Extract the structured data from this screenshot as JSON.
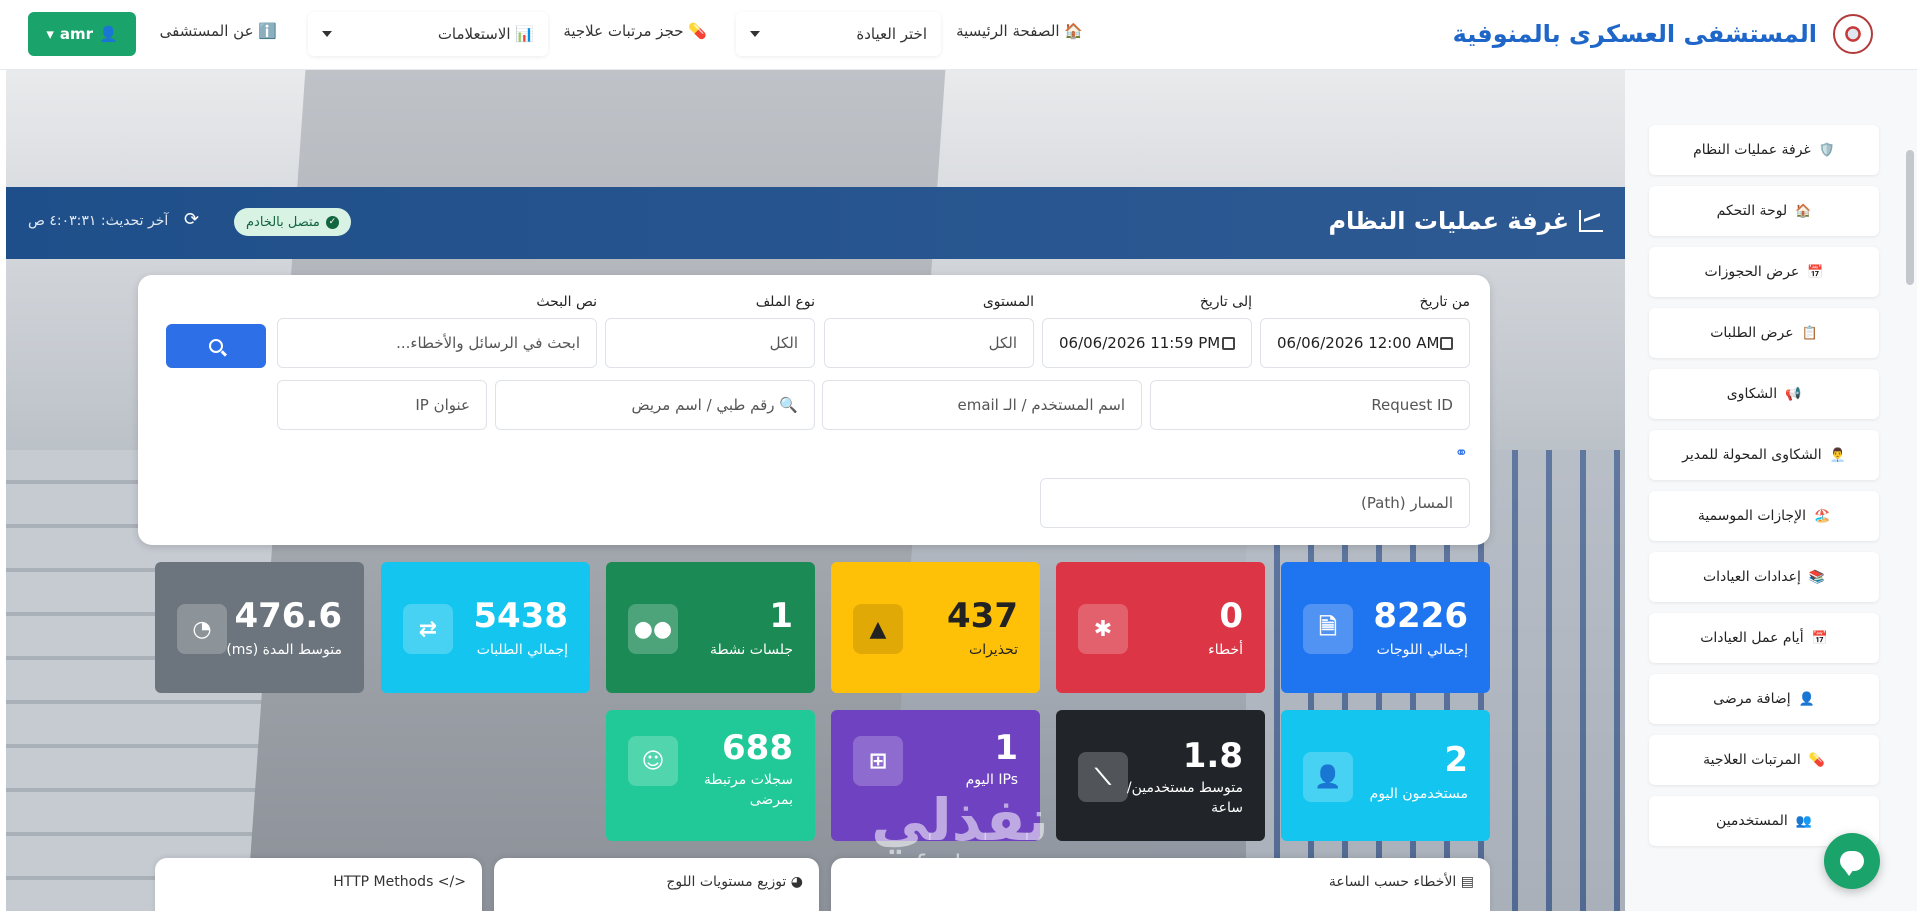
{
  "navbar": {
    "brand_title": "المستشفى العسكرى بالمنوفية",
    "home": "🏠 الصفحة الرئيسية",
    "clinic_select": "اختر العيادة",
    "book_salary": "💊 حجز مرتبات علاجية",
    "inquiries_select": "📊 الاستعلامات",
    "about": "ℹ️ عن المستشفى",
    "user": "amr"
  },
  "ops": {
    "title": "غرفة عمليات النظام",
    "status": "متصل بالخادم",
    "last_update": "آخر تحديث: ٤:٠٣:٣١ ص"
  },
  "filters": {
    "from_date_label": "من تاريخ",
    "from_date_value": "06/06/2026 12:00 AM",
    "to_date_label": "إلى تاريخ",
    "to_date_value": "06/06/2026 11:59 PM",
    "level_label": "المستوى",
    "level_value": "الكل",
    "file_type_label": "نوع الملف",
    "file_type_value": "الكل",
    "search_text_label": "نص البحث",
    "search_text_placeholder": "ابحث في الرسائل والأخطاء...",
    "request_id_placeholder": "Request ID",
    "user_placeholder": "اسم المستخدم / الـ email",
    "medical_placeholder": "🔍 رقم طبي / اسم مريض",
    "ip_placeholder": "عنوان IP",
    "path_placeholder": "المسار (Path)"
  },
  "stats": [
    {
      "value": "8226",
      "label": "إجمالي اللوجات",
      "color": "#1f75f0",
      "icon": "file-icon"
    },
    {
      "value": "0",
      "label": "أخطاء",
      "color": "#dc3545",
      "icon": "bug-icon"
    },
    {
      "value": "437",
      "label": "تحذيرات",
      "color": "#ffc107",
      "icon": "warning-icon"
    },
    {
      "value": "1",
      "label": "جلسات نشطة",
      "color": "#1b8a55",
      "icon": "users-icon"
    },
    {
      "value": "5438",
      "label": "إجمالي الطلبات",
      "color": "#14c5ef",
      "icon": "exchange-icon"
    },
    {
      "value": "476.6",
      "label": "متوسط المدة (ms)",
      "color": "#6c757d",
      "icon": "gauge-icon"
    },
    {
      "value": "2",
      "label": "مستخدمون اليوم",
      "color": "#14c5ef",
      "icon": "user-plus-icon"
    },
    {
      "value": "1.8",
      "label": "متوسط مستخدمين/ ساعة",
      "color": "#212529",
      "icon": "line-chart-icon"
    },
    {
      "value": "1",
      "label": "IPs اليوم",
      "color": "#6f42c1",
      "icon": "network-icon"
    },
    {
      "value": "688",
      "label": "سجلات مرتبطة بمرضى",
      "color": "#20c997",
      "icon": "patient-icon"
    }
  ],
  "panels": {
    "errors_by_hour": "الأخطاء حسب الساعة",
    "levels_dist": "توزيع مستويات اللوج",
    "http_methods": "HTTP Methods"
  },
  "sidebar": {
    "items": [
      {
        "label": "غرفة عمليات النظام",
        "icon": "🛡️"
      },
      {
        "label": "لوحة التحكم",
        "icon": "🏠"
      },
      {
        "label": "عرض الحجوزات",
        "icon": "📅"
      },
      {
        "label": "عرض الطلبات",
        "icon": "📋"
      },
      {
        "label": "الشكاوى",
        "icon": "📢"
      },
      {
        "label": "الشكاوى المحولة للمدير",
        "icon": "👨‍💼"
      },
      {
        "label": "الإجازات الموسمية",
        "icon": "🏖️"
      },
      {
        "label": "إعدادات العيادات",
        "icon": "📚"
      },
      {
        "label": "أيام عمل العيادات",
        "icon": "📅"
      },
      {
        "label": "إضافة مرضى",
        "icon": "👤"
      },
      {
        "label": "المرتبات العلاجية",
        "icon": "💊"
      },
      {
        "label": "المستخدمين",
        "icon": "👥"
      }
    ]
  },
  "watermark": {
    "arabic": "نفذلي",
    "latin": "nafezly.com"
  }
}
